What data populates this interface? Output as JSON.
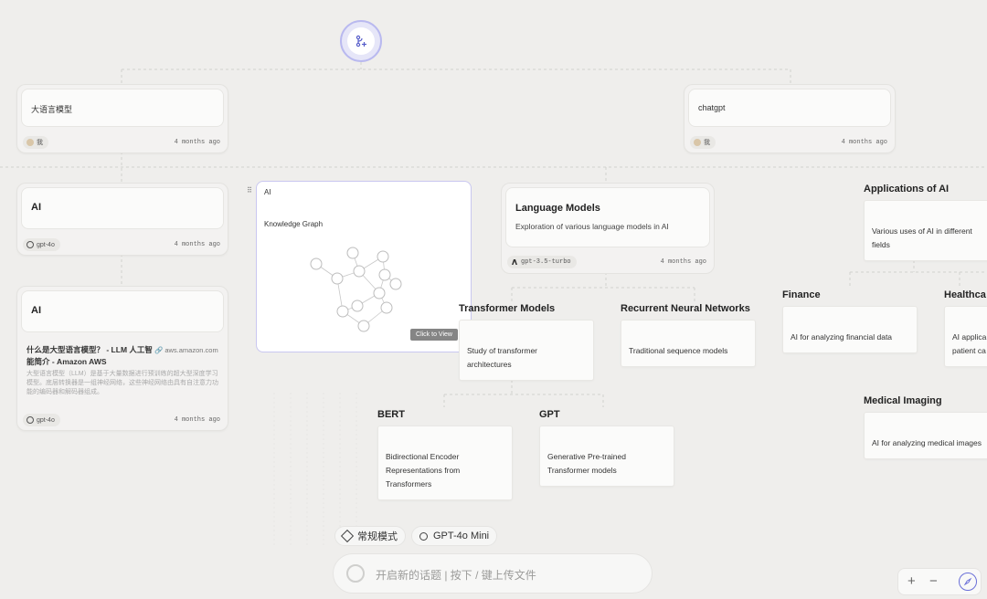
{
  "root_node": {
    "icon": "branch-plus-icon"
  },
  "top_nodes": [
    {
      "text": "大语言模型",
      "author": "我",
      "time": "4 months ago"
    },
    {
      "text": "chatgpt",
      "author": "我",
      "time": "4 months ago"
    }
  ],
  "ai_card_1": {
    "title": "AI",
    "model": "gpt-4o",
    "time": "4 months ago"
  },
  "ai_card_2": {
    "title": "AI",
    "result_title": "什么是大型语言模型？ - LLM 人工智能简介 - Amazon AWS",
    "result_source": "aws.amazon.com",
    "result_snippet": "大型语言模型（LLM）是基于大量数据进行预训练的超大型深度学习模型。底层转换器是一组神经网络，这些神经网络由具有自注意力功能的编码器和解码器组成。",
    "model": "gpt-4o",
    "time": "4 months ago"
  },
  "knowledge_graph": {
    "label": "AI",
    "subtitle": "Knowledge Graph",
    "button": "Click to View"
  },
  "language_models": {
    "title": "Language Models",
    "description": "Exploration of various language models in AI",
    "model": "gpt-3.5-turbo",
    "time": "4 months ago"
  },
  "mind_nodes": {
    "transformer": {
      "title": "Transformer Models",
      "desc_1": "Study of transformer",
      "desc_2": "architectures"
    },
    "rnn": {
      "title": "Recurrent Neural Networks",
      "desc_1": "Traditional sequence models"
    },
    "bert": {
      "title": "BERT",
      "desc_1": "Bidirectional Encoder",
      "desc_2": "Representations from",
      "desc_3": "Transformers"
    },
    "gpt": {
      "title": "GPT",
      "desc_1": "Generative Pre-trained",
      "desc_2": "Transformer models"
    },
    "applications": {
      "title": "Applications of AI",
      "desc_1": "Various uses of AI in different",
      "desc_2": "fields"
    },
    "finance": {
      "title": "Finance",
      "desc_1": "AI for analyzing financial data"
    },
    "healthcare": {
      "title": "Healthca",
      "desc_1": "AI applica",
      "desc_2": "patient ca"
    },
    "medical": {
      "title": "Medical Imaging",
      "desc_1": "AI for analyzing medical images"
    }
  },
  "mode_pill": {
    "label": "常规模式",
    "icon": "diamond-icon"
  },
  "model_pill": {
    "label": "GPT-4o Mini",
    "icon": "openai-icon"
  },
  "input": {
    "placeholder": "开启新的话题 | 按下 / 键上传文件"
  },
  "zoom": {
    "plus": "+",
    "minus": "−",
    "compass_icon": "compass-icon"
  },
  "colors": {
    "accent": "#6a6fd8",
    "background": "#efeeec",
    "card": "#fbfbfa"
  }
}
